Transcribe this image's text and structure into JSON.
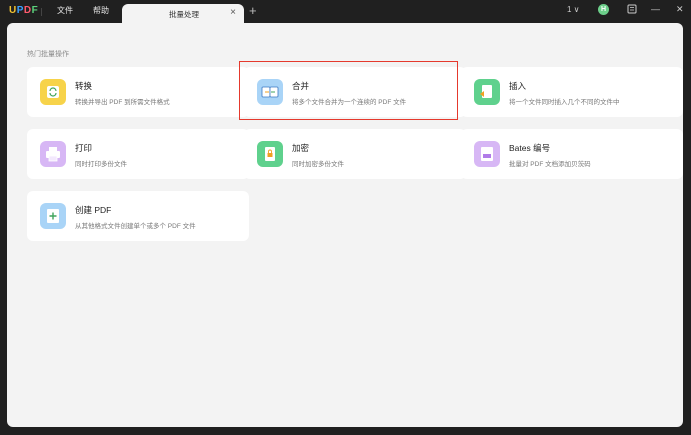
{
  "app": {
    "logo": {
      "u": "U",
      "p": "P",
      "d": "D",
      "f": "F"
    },
    "menu": {
      "file": "文件",
      "help": "帮助"
    },
    "tab": {
      "label": "批量处理",
      "close": "×",
      "add": "+"
    },
    "version": "1 ∨",
    "avatar": "H",
    "window": {
      "minimize": "—",
      "maximize": "☐",
      "close": "✕"
    }
  },
  "main": {
    "section_title": "热门批量操作",
    "cards": [
      {
        "title": "转换",
        "desc": "转换并导出 PDF 到所需文件格式",
        "icon": "convert-icon",
        "color": "#f7d34a"
      },
      {
        "title": "合并",
        "desc": "将多个文件合并为一个连续的 PDF 文件",
        "icon": "merge-icon",
        "color": "#a9d4f7"
      },
      {
        "title": "插入",
        "desc": "将一个文件同时插入几个不同的文件中",
        "icon": "insert-icon",
        "color": "#5fd18d"
      },
      {
        "title": "打印",
        "desc": "同时打印多份文件",
        "icon": "print-icon",
        "color": "#d7b7f5"
      },
      {
        "title": "加密",
        "desc": "同时加密多份文件",
        "icon": "encrypt-icon",
        "color": "#5fd18d"
      },
      {
        "title": "Bates 编号",
        "desc": "批量对 PDF 文档添加贝茨码",
        "icon": "bates-icon",
        "color": "#d7b7f5"
      },
      {
        "title": "创建 PDF",
        "desc": "从其他格式文件创建单个或多个 PDF 文件",
        "icon": "create-pdf-icon",
        "color": "#a9d4f7"
      }
    ]
  },
  "colors": {
    "highlight": "#e5392d",
    "accent": "#5fd18d"
  }
}
